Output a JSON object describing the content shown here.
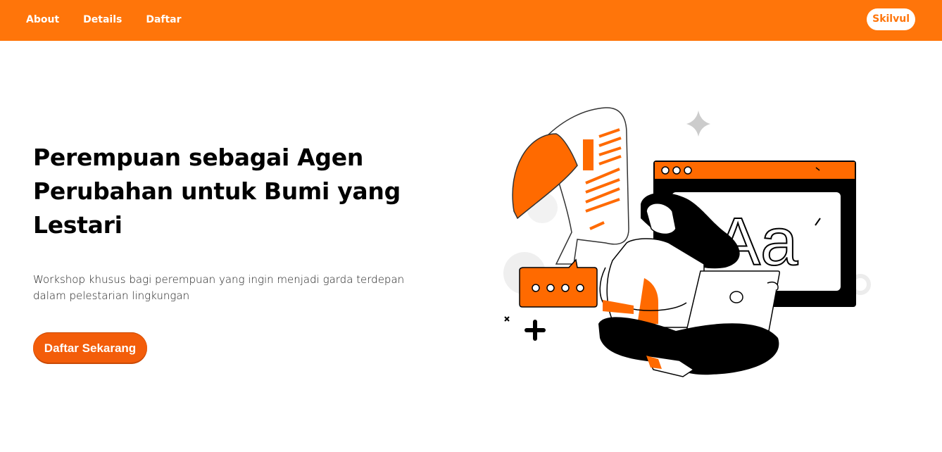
{
  "navbar": {
    "links": [
      "About",
      "Details",
      "Daftar"
    ],
    "logo": "Skilvul"
  },
  "hero": {
    "title": "Perempuan sebagai Agen Perubahan untuk Bumi yang Lestari",
    "subtitle": "Workshop khusus bagi perempuan yang ingin menjadi garda terdepan dalam pelestarian lingkungan",
    "cta_label": "Daftar Sekarang"
  },
  "illustration": {
    "window_text": "Aa",
    "accent_color": "#ff750a"
  },
  "colors": {
    "brand": "#ff750a",
    "cta": "#f35d0a"
  }
}
